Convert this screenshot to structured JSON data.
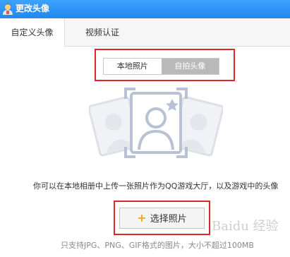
{
  "window": {
    "title": "更改头像"
  },
  "tabs": [
    {
      "label": "自定义头像",
      "active": true
    },
    {
      "label": "视频认证",
      "active": false
    }
  ],
  "source_toggle": {
    "options": [
      "本地照片",
      "自拍头像"
    ],
    "selected": "本地照片"
  },
  "main": {
    "description": "你可以在本地相册中上传一张照片作为QQ游戏大厅，以及游戏中的头像",
    "choose_button": {
      "icon": "plus-icon",
      "label": "选择照片"
    },
    "format_note": "只支持JPG、PNG、GIF格式的图片，大小不超过100MB"
  },
  "watermark": "Baidu 经验",
  "colors": {
    "titlebar": "#2a8ff2",
    "highlight": "#e02626",
    "plus": "#f5a623",
    "toggle_inactive": "#b9b9b9"
  }
}
